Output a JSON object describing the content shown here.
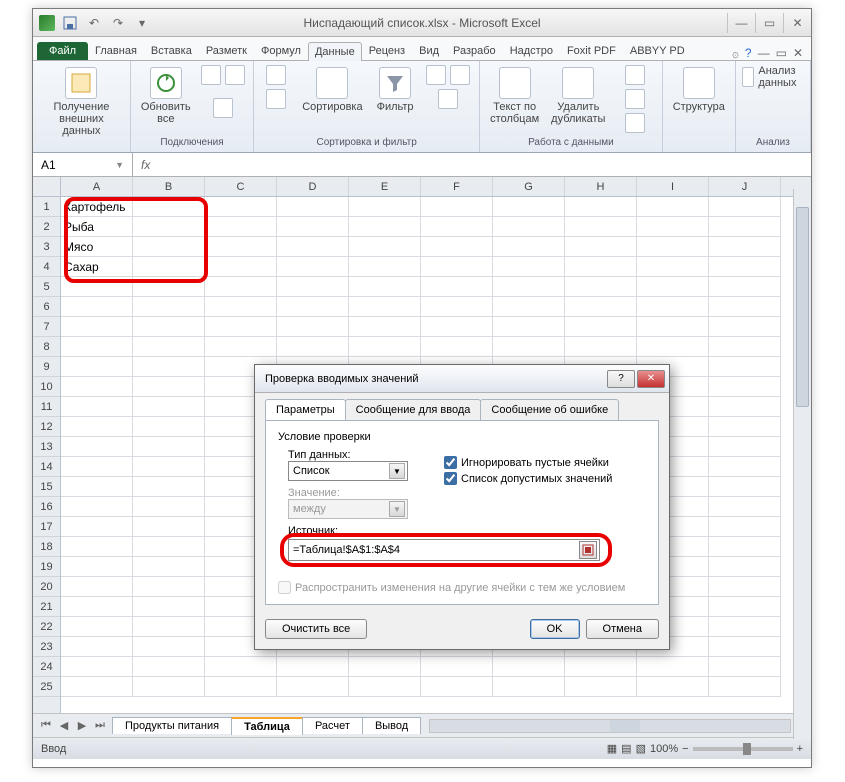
{
  "window": {
    "title": "Ниспадающий список.xlsx - Microsoft Excel"
  },
  "tabs": {
    "file": "Файл",
    "items": [
      "Главная",
      "Вставка",
      "Разметк",
      "Формул",
      "Данные",
      "Реценз",
      "Вид",
      "Разрабо",
      "Надстро",
      "Foxit PDF",
      "ABBYY PD"
    ],
    "active_index": 4
  },
  "ribbon": {
    "g1_btn": "Получение\nвнешних данных",
    "g2_btn": "Обновить\nвсе",
    "g2_label": "Подключения",
    "g3_btn": "Сортировка",
    "g3_btn2": "Фильтр",
    "g3_label": "Сортировка и фильтр",
    "g4_btn": "Текст по\nстолбцам",
    "g4_btn2": "Удалить\nдубликаты",
    "g4_label": "Работа с данными",
    "g5_btn": "Структура",
    "g6_btn": "Анализ данных",
    "g6_label": "Анализ"
  },
  "formula": {
    "name_box": "A1",
    "fx": "fx"
  },
  "columns": [
    "A",
    "B",
    "C",
    "D",
    "E",
    "F",
    "G",
    "H",
    "I",
    "J"
  ],
  "cells": {
    "a1": "Картофель",
    "a2": "Рыба",
    "a3": "Мясо",
    "a4": "Сахар"
  },
  "sheets": {
    "items": [
      "Продукты питания",
      "Таблица",
      "Расчет",
      "Вывод"
    ],
    "active_index": 1
  },
  "status": {
    "mode": "Ввод",
    "zoom": "100%"
  },
  "dialog": {
    "title": "Проверка вводимых значений",
    "tabs": [
      "Параметры",
      "Сообщение для ввода",
      "Сообщение об ошибке"
    ],
    "section": "Условие проверки",
    "type_label": "Тип данных:",
    "type_value": "Список",
    "value_label": "Значение:",
    "value_value": "между",
    "chk1": "Игнорировать пустые ячейки",
    "chk2": "Список допустимых значений",
    "source_label": "Источник:",
    "source_value": "=Таблица!$A$1:$A$4",
    "propagate": "Распространить изменения на другие ячейки с тем же условием",
    "clear": "Очистить все",
    "ok": "OK",
    "cancel": "Отмена"
  }
}
